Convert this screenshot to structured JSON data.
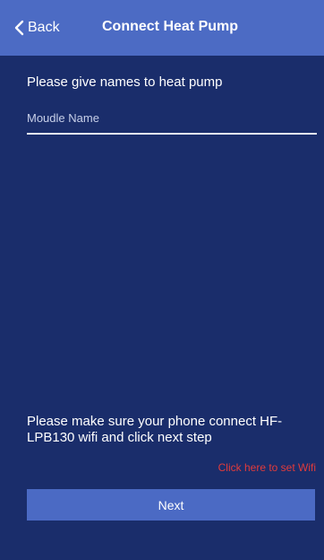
{
  "header": {
    "back_label": "Back",
    "back_icon": "chevron-left-icon",
    "title": "Connect Heat Pump"
  },
  "form": {
    "prompt": "Please give names to heat pump",
    "module_name_placeholder": "Moudle Name",
    "module_name_value": ""
  },
  "footer": {
    "hint": "Please make sure your phone connect HF-LPB130 wifi and click next step",
    "wifi_link": "Click here to set Wifi",
    "next_label": "Next"
  },
  "colors": {
    "background": "#1a2d6b",
    "header": "#4c6bc4",
    "button": "#4b6ac4",
    "link": "#e23b3b"
  }
}
